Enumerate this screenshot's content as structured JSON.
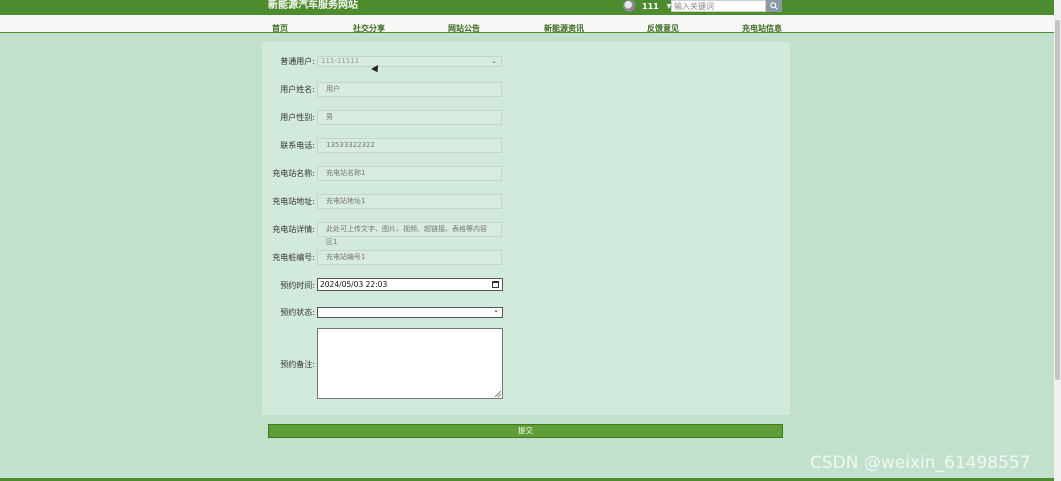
{
  "header": {
    "site_title": "新能源汽车服务网站",
    "username": "111",
    "search_placeholder": "输入关键词"
  },
  "nav": {
    "items": [
      {
        "label": "首页"
      },
      {
        "label": "社交分享"
      },
      {
        "label": "网站公告"
      },
      {
        "label": "新能源资讯"
      },
      {
        "label": "反馈意见"
      },
      {
        "label": "充电站信息"
      }
    ]
  },
  "form": {
    "fields": [
      {
        "label": "普通用户:",
        "value": "111-11111"
      },
      {
        "label": "用户姓名:",
        "value": "用户"
      },
      {
        "label": "用户性别:",
        "value": "男"
      },
      {
        "label": "联系电话:",
        "value": "13533322322"
      },
      {
        "label": "充电站名称:",
        "value": "充电站名称1"
      },
      {
        "label": "充电站地址:",
        "value": "充电站地址1"
      },
      {
        "label": "充电站详情:",
        "value": "此处可上传文字、图片、视频、超链接、表格等内容区1"
      },
      {
        "label": "充电桩编号:",
        "value": "充电站编号1"
      },
      {
        "label": "预约时间:",
        "value": "2024/05/03 22:03"
      },
      {
        "label": "预约状态:",
        "value": ""
      },
      {
        "label": "预约备注:",
        "value": ""
      }
    ],
    "submit_label": "提交"
  },
  "watermark": "CSDN @weixin_61498557",
  "colors": {
    "header_green": "#4c8b2e",
    "page_bg": "#c2e1cd",
    "panel_bg": "#d2eadb",
    "button_green": "#5f9e37"
  },
  "icons": [
    "avatar-icon",
    "caret-down-icon",
    "search-icon",
    "chevron-down-icon",
    "calendar-icon",
    "mouse-cursor-icon"
  ]
}
